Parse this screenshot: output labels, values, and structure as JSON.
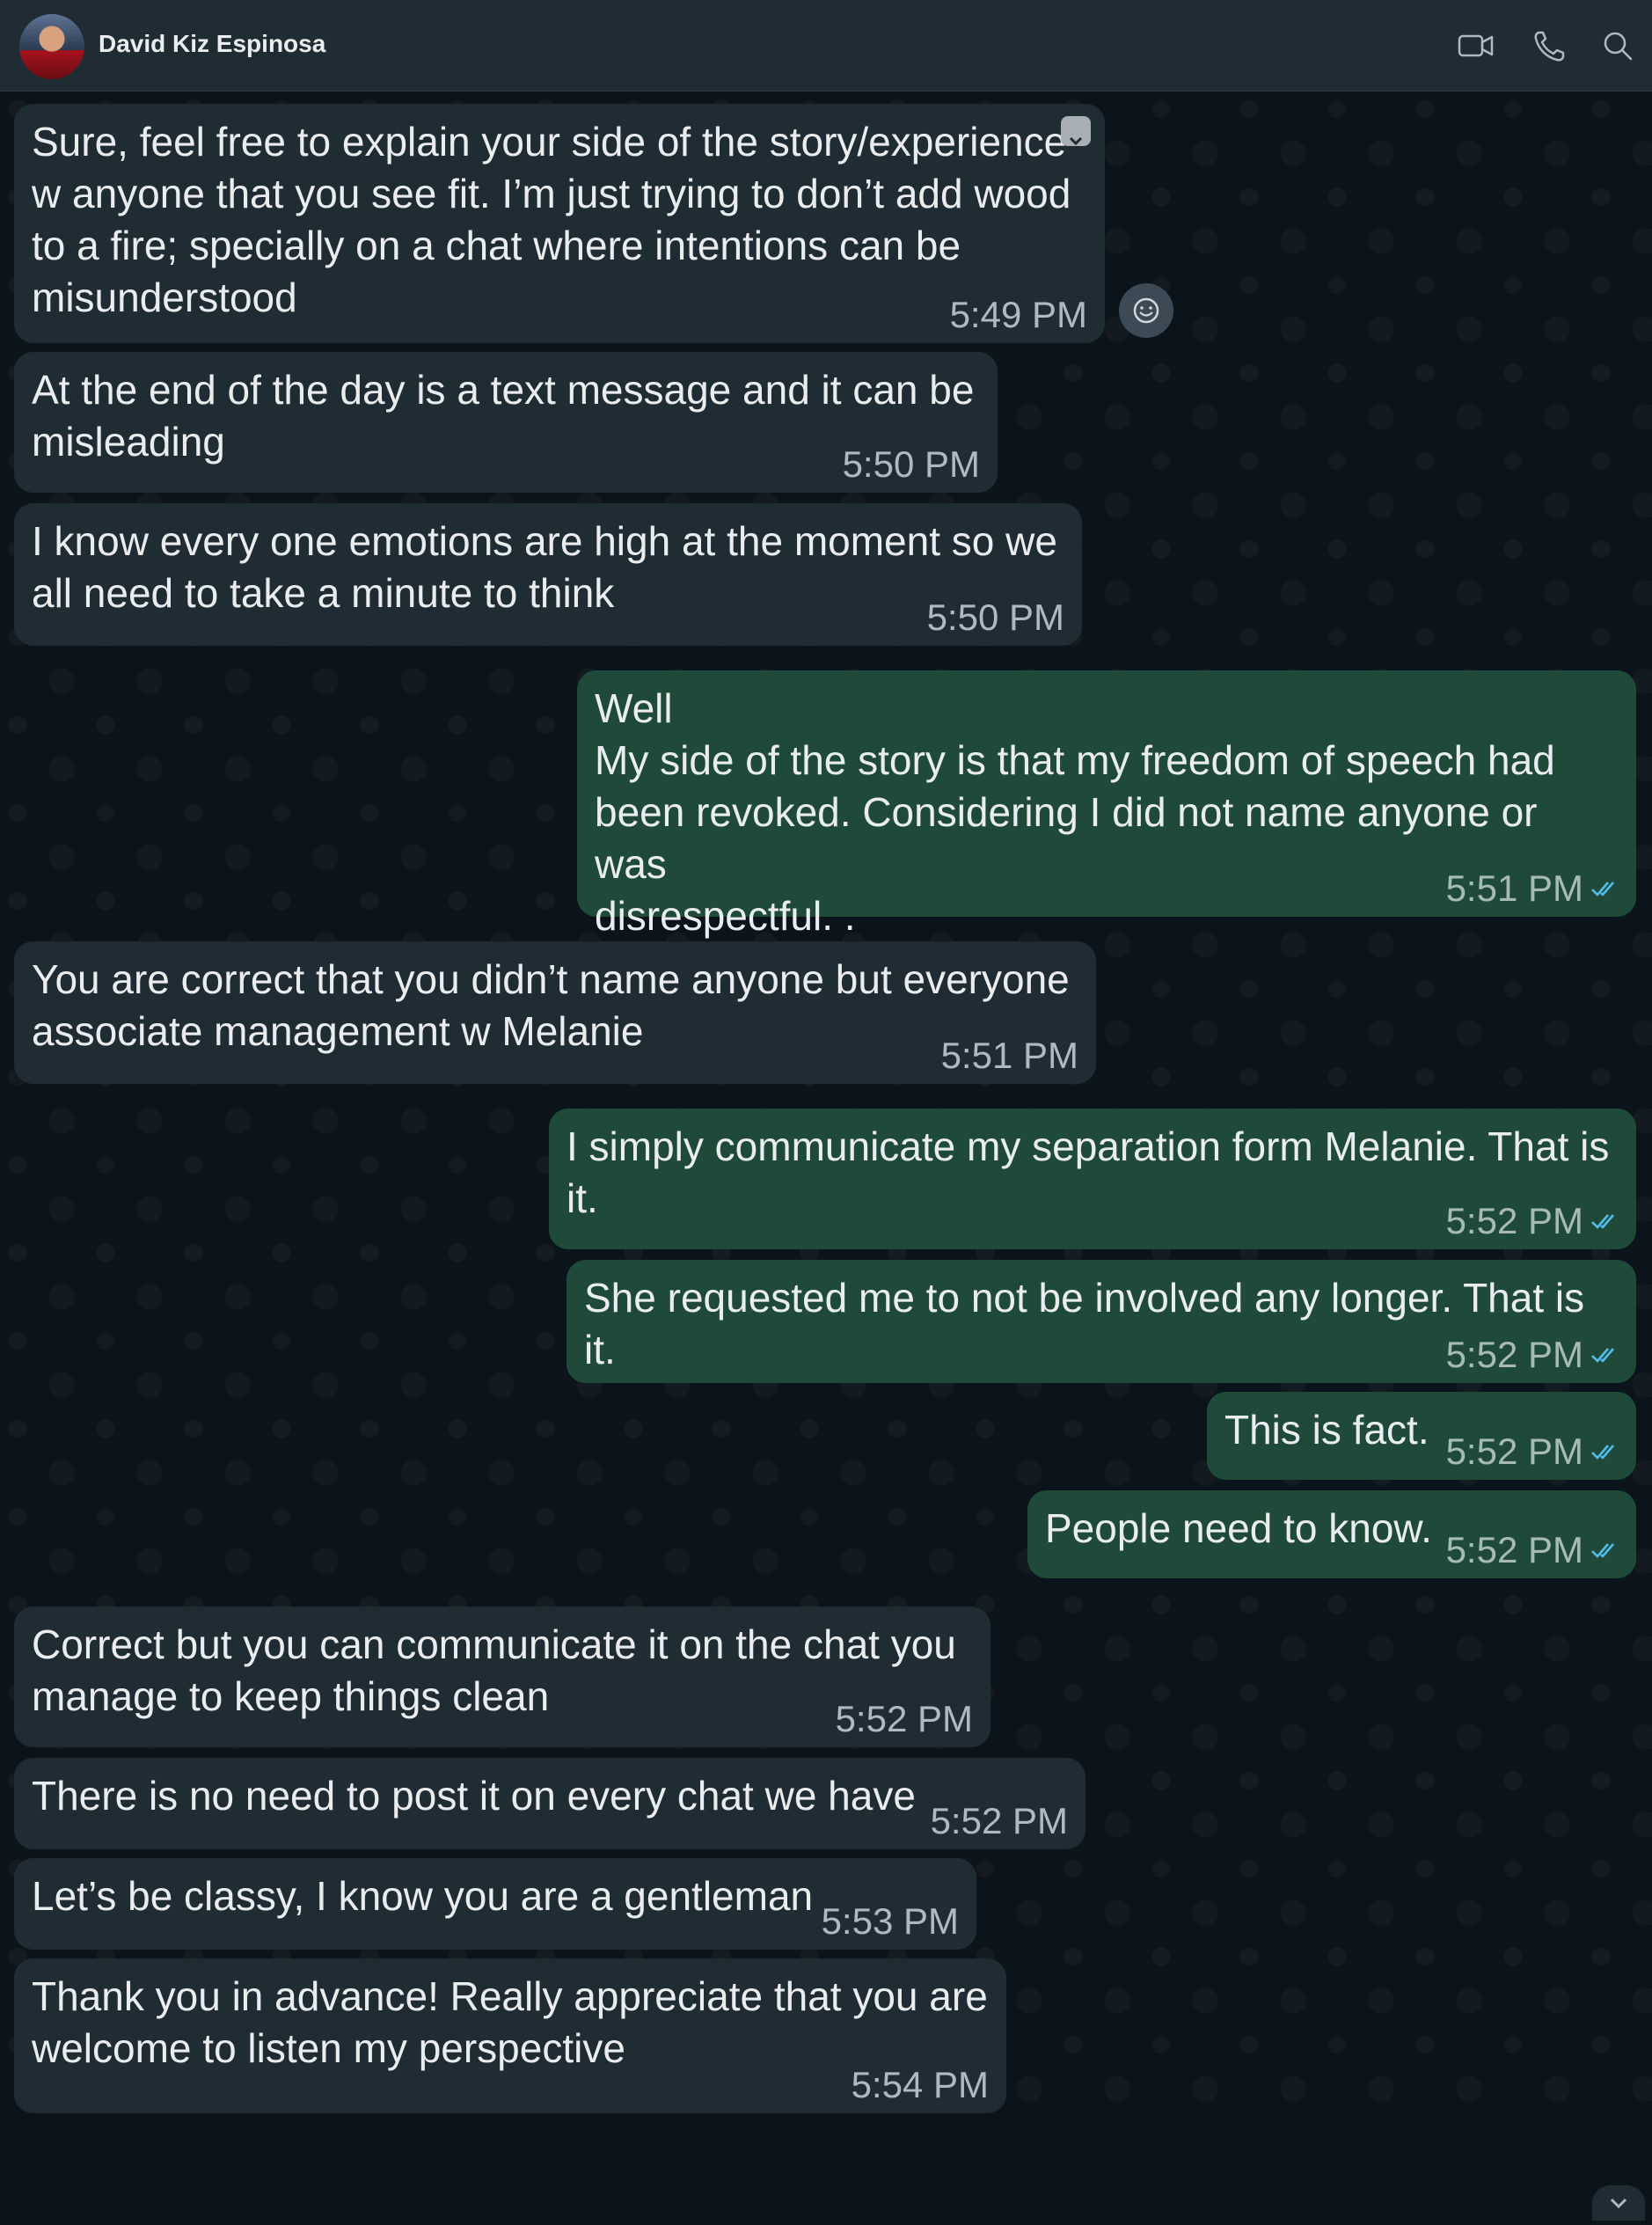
{
  "header": {
    "contact_name": "David Kiz Espinosa",
    "icons": [
      "avatar",
      "video-call-icon",
      "voice-call-icon",
      "search-icon"
    ]
  },
  "colors": {
    "incoming_bubble": "#202c33",
    "outgoing_bubble": "#1f4a3a",
    "read_ticks": "#53bdeb",
    "header_bg": "#202c33",
    "chat_bg": "#0b141a"
  },
  "messages": [
    {
      "dir": "in",
      "text": "Sure, feel free to explain your side of the story/experience\nw anyone that you see fit. I’m just trying to don’t add wood\nto a fire; specially on a chat where intentions can be\nmisunderstood",
      "time": "5:49 PM"
    },
    {
      "dir": "in",
      "text": "At the end of the day is a text message and it can be\nmisleading",
      "time": "5:50 PM"
    },
    {
      "dir": "in",
      "text": "I know every one emotions are high at the moment so we\nall need to take a minute to think",
      "time": "5:50 PM"
    },
    {
      "dir": "out",
      "text": "Well\nMy side of the story is that my freedom of speech had\nbeen revoked. Considering I did not name anyone or was\ndisrespectful. .",
      "time": "5:51 PM",
      "status": "read"
    },
    {
      "dir": "in",
      "text": "You are correct that you didn’t name anyone but everyone\nassociate management w Melanie",
      "time": "5:51 PM"
    },
    {
      "dir": "out",
      "text": "I simply communicate my separation form Melanie. That is\nit.",
      "time": "5:52 PM",
      "status": "read"
    },
    {
      "dir": "out",
      "text": "She requested me to not be involved any longer. That is it.",
      "time": "5:52 PM",
      "status": "read"
    },
    {
      "dir": "out",
      "text": "This is fact.",
      "time": "5:52 PM",
      "status": "read"
    },
    {
      "dir": "out",
      "text": "People need to know.",
      "time": "5:52 PM",
      "status": "read"
    },
    {
      "dir": "in",
      "text": "Correct but you can communicate it on the chat you\nmanage to keep things clean",
      "time": "5:52 PM"
    },
    {
      "dir": "in",
      "text": "There is no need to post it on every chat we have",
      "time": "5:52 PM"
    },
    {
      "dir": "in",
      "text": "Let’s be classy, I know you are a gentleman",
      "time": "5:53 PM"
    },
    {
      "dir": "in",
      "text": "Thank you in advance! Really appreciate that you are\nwelcome to listen my perspective",
      "time": "5:54 PM"
    }
  ]
}
